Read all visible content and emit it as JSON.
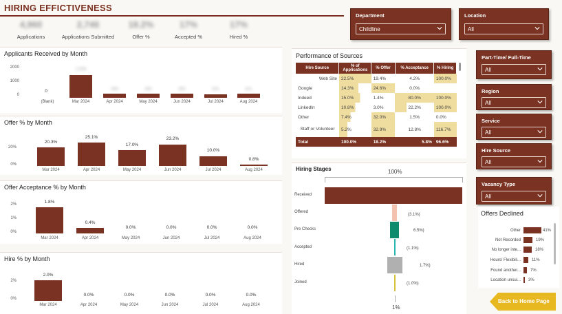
{
  "header": {
    "title": "HIRING EFFICTIVENESS"
  },
  "kpis": [
    {
      "value": "4,960",
      "label": "Applications"
    },
    {
      "value": "2,746",
      "label": "Applications Submitted"
    },
    {
      "value": "18.2%",
      "label": "Offer %"
    },
    {
      "value": "17%",
      "label": "Accepted %"
    },
    {
      "value": "17%",
      "label": "Hired %"
    }
  ],
  "slicers": {
    "department": {
      "label": "Department",
      "value": "Childline"
    },
    "location": {
      "label": "Location",
      "value": "All"
    },
    "parttime": {
      "label": "Part-Time/ Full-Time",
      "value": "All"
    },
    "region": {
      "label": "Region",
      "value": "All"
    },
    "service": {
      "label": "Service",
      "value": "All"
    },
    "hire_source": {
      "label": "Hire Source",
      "value": "All"
    },
    "vacancy_type": {
      "label": "Vacancy Type",
      "value": "All"
    }
  },
  "applicants": {
    "title": "Applicants Received by Month",
    "yticks": [
      "2000",
      "1000",
      "0"
    ],
    "months": [
      "(Blank)",
      "Mar 2024",
      "Apr 2024",
      "May 2024",
      "Jun 2024",
      "Jul 2024",
      "Aug 2024"
    ],
    "labels": [
      "0",
      "1,556",
      "358",
      "390",
      "350",
      "301",
      "321"
    ]
  },
  "offer": {
    "title": "Offer % by Month",
    "yticks": [
      "20%",
      "0%"
    ],
    "months": [
      "Mar 2024",
      "Apr 2024",
      "May 2024",
      "Jun 2024",
      "Jul 2024",
      "Aug 2024"
    ],
    "labels": [
      "20.3%",
      "25.1%",
      "17.0%",
      "23.2%",
      "10.0%",
      "0.8%"
    ]
  },
  "acceptance": {
    "title": "Offer Acceptance % by Month",
    "yticks": [
      "2%",
      "1%",
      "0%"
    ],
    "months": [
      "Mar 2024",
      "Apr 2024",
      "May 2024",
      "Jun 2024",
      "Jul 2024",
      "Aug 2024"
    ],
    "labels": [
      "1.8%",
      "0.4%",
      "0.0%",
      "0.0%",
      "0.0%",
      "0.0%"
    ]
  },
  "hire": {
    "title": "Hire % by Month",
    "yticks": [
      "2%",
      "0%"
    ],
    "months": [
      "Mar 2024",
      "Apr 2024",
      "May 2024",
      "Jun 2024",
      "Jul 2024",
      "Aug 2024"
    ],
    "labels": [
      "2.0%",
      "0.0%",
      "0.0%",
      "0.0%",
      "0.0%",
      "0.0%"
    ]
  },
  "performance": {
    "title": "Performance of Sources",
    "headers": [
      "Hire Source",
      "% of Applications",
      "% Offer",
      "% Acceptance",
      "% Hiring"
    ],
    "rows": [
      [
        "Web Site",
        "22.5%",
        "19.4%",
        "4.2%",
        "100.0%"
      ],
      [
        "Google",
        "14.3%",
        "24.6%",
        "0.0%",
        ""
      ],
      [
        "Indeed",
        "15.0%",
        "1.4%",
        "80.0%",
        "100.0%"
      ],
      [
        "LinkedIn",
        "10.8%",
        "3.0%",
        "22.2%",
        "100.0%"
      ],
      [
        "Other",
        "7.4%",
        "32.0%",
        "1.5%",
        "0.0%"
      ],
      [
        "Staff or Volunteer",
        "5.2%",
        "32.9%",
        "12.8%",
        "116.7%"
      ]
    ],
    "total": [
      "Total",
      "100.0%",
      "18.2%",
      "5.8%",
      "96.6%"
    ]
  },
  "stages": {
    "title": "Hiring Stages",
    "top_label": "100%",
    "bottom_label": "1%",
    "items": [
      {
        "name": "Received",
        "pct": ""
      },
      {
        "name": "Offered",
        "pct": "(3.1%)"
      },
      {
        "name": "Pre Checks",
        "pct": "6.5%)"
      },
      {
        "name": "Accepted",
        "pct": "(1.1%)"
      },
      {
        "name": "Hired",
        "pct": "1.7%)"
      },
      {
        "name": "Joined",
        "pct": "(1.0%)"
      }
    ]
  },
  "declined": {
    "title": "Offers Declined",
    "items": [
      {
        "name": "Other",
        "pct": "41%",
        "value": 41
      },
      {
        "name": "Not Recorded",
        "pct": "19%",
        "value": 19
      },
      {
        "name": "No longer inte...",
        "pct": "18%",
        "value": 18
      },
      {
        "name": "Hours/ Flexibili...",
        "pct": "11%",
        "value": 11
      },
      {
        "name": "Found another...",
        "pct": "7%",
        "value": 7
      },
      {
        "name": "Location unsui...",
        "pct": "3%",
        "value": 3
      }
    ]
  },
  "nav": {
    "home_label": "Back to Home Page"
  },
  "colors": {
    "brand": "#7a3322",
    "highlight": "#efdda0",
    "pink": "#f2c4b0",
    "teal": "#0e8a6c",
    "cyan": "#2cb5b0",
    "gray": "#b0b0b0",
    "gold": "#d6c040",
    "nav_gold": "#e8b820"
  }
}
